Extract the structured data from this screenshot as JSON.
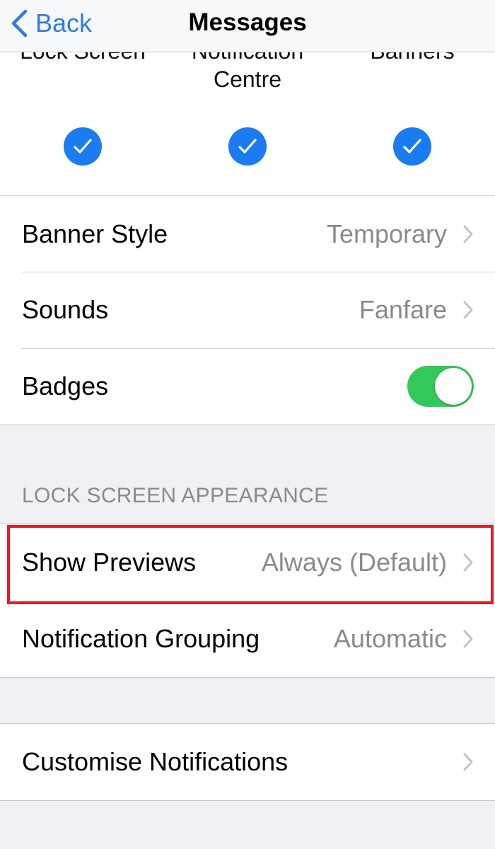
{
  "navbar": {
    "back_label": "Back",
    "title": "Messages"
  },
  "alerts": [
    {
      "label": "Lock Screen",
      "checked": true
    },
    {
      "label": "Notification Centre",
      "checked": true
    },
    {
      "label": "Banners",
      "checked": true
    }
  ],
  "settings": {
    "banner_style": {
      "label": "Banner Style",
      "value": "Temporary"
    },
    "sounds": {
      "label": "Sounds",
      "value": "Fanfare"
    },
    "badges": {
      "label": "Badges",
      "enabled": true
    }
  },
  "lock_screen": {
    "header": "LOCK SCREEN APPEARANCE",
    "show_previews": {
      "label": "Show Previews",
      "value": "Always (Default)"
    },
    "notification_grouping": {
      "label": "Notification Grouping",
      "value": "Automatic"
    }
  },
  "customise": {
    "label": "Customise Notifications"
  },
  "colors": {
    "accent": "#2f7de1",
    "check": "#1a7cf0",
    "toggle_on": "#34c759",
    "highlight": "#e41b23"
  },
  "icons": {
    "back": "chevron-left-icon",
    "row": "chevron-right-icon",
    "check": "checkmark-circle-icon"
  }
}
